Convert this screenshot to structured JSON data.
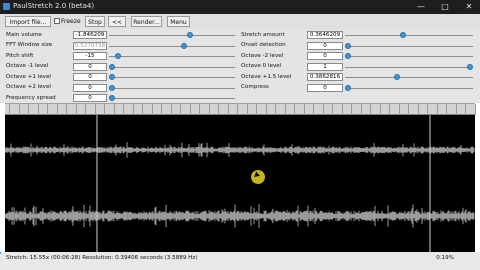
{
  "window": {
    "title": "PaulStretch 2.0 (beta4)",
    "minimize": "—",
    "maximize": "□",
    "close": "✕"
  },
  "toolbar": {
    "import_label": "Import file...",
    "freeze_label": "Freeze",
    "stop_label": "Stop",
    "back_label": "<<",
    "render_label": "Render...",
    "menu_label": "Menu"
  },
  "params_left": [
    {
      "label": "Main volume",
      "value": "-1.846209",
      "level": 0.65,
      "dim": false
    },
    {
      "label": "FFT Window size",
      "value": "0.5270738",
      "level": 0.6,
      "dim": true
    },
    {
      "label": "Pitch shift",
      "value": "-15",
      "level": 0.05,
      "dim": false
    },
    {
      "label": "Octave -1 level",
      "value": "0",
      "level": 0.0,
      "dim": false
    },
    {
      "label": "Octave +1 level",
      "value": "0",
      "level": 0.0,
      "dim": false
    },
    {
      "label": "Octave +2 level",
      "value": "0",
      "level": 0.0,
      "dim": false
    },
    {
      "label": "Frequency spread",
      "value": "0",
      "level": 0.0,
      "dim": false
    }
  ],
  "params_right": [
    {
      "label": "Stretch amount",
      "value": "0.3646209",
      "level": 0.45,
      "dim": false
    },
    {
      "label": "Onset detection",
      "value": "0",
      "level": 0.0,
      "dim": false
    },
    {
      "label": "Octave -2 level",
      "value": "0",
      "level": 0.0,
      "dim": false
    },
    {
      "label": "Octave 0 level",
      "value": "1",
      "level": 1.0,
      "dim": false
    },
    {
      "label": "Octave +1.5 level",
      "value": "0.3862816",
      "level": 0.4,
      "dim": false
    },
    {
      "label": "Compress",
      "value": "0",
      "level": 0.0,
      "dim": false
    }
  ],
  "status": {
    "text": "Stretch: 15.55x (00:06:28) Resolution: 0.39406 seconds (3.5889 Hz)",
    "percent": "0.19%",
    "progress": 0.0019
  },
  "colors": {
    "accent": "#3f94d6",
    "waveform_bg": "#000000",
    "waveform_fg": "#9a9a9a"
  }
}
